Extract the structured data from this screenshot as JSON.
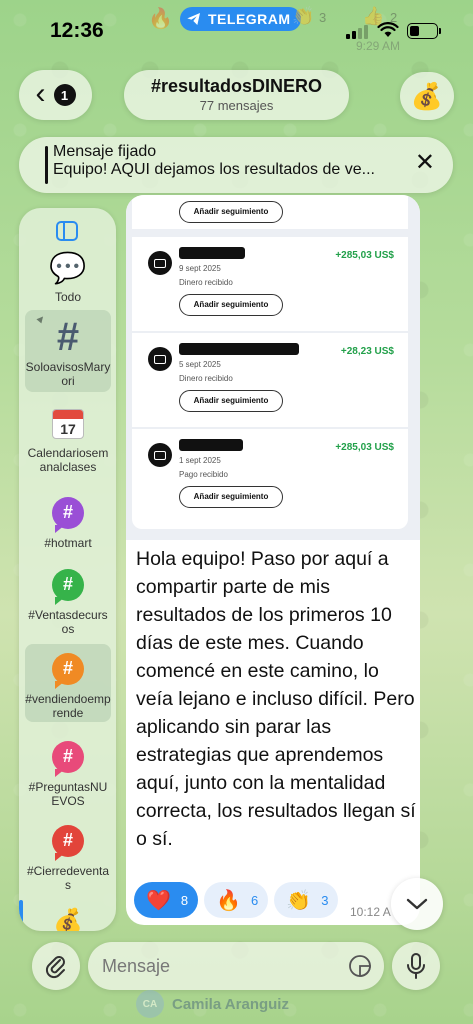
{
  "status_bar": {
    "time": "12:36",
    "telegram_label": "TELEGRAM",
    "faded_time": "9:29 AM",
    "faded_count_1": "3",
    "faded_count_2": "2"
  },
  "header": {
    "back_badge": "1",
    "title": "#resultadosDINERO",
    "subtitle": "77 mensajes",
    "avatar_emoji": "💰"
  },
  "pinned": {
    "label": "Mensaje fijado",
    "text": "Equipo! AQUI dejamos los resultados de ve..."
  },
  "sidebar": {
    "items": [
      {
        "label": "Todo",
        "icon": "chat-bubbles-icon"
      },
      {
        "label": "SoloavisosMaryori",
        "icon": "hash-icon"
      },
      {
        "label": "Calendariosemanalclases",
        "icon": "calendar-icon",
        "day": "17"
      },
      {
        "label": "#hotmart",
        "icon": "hash-icon",
        "color": "#9a4fd6"
      },
      {
        "label": "#Ventasdecursos",
        "icon": "hash-icon",
        "color": "#36b34a"
      },
      {
        "label": "#vendiendoemprende",
        "icon": "hash-icon",
        "color": "#f08a24"
      },
      {
        "label": "#PreguntasNUEVOS",
        "icon": "hash-icon",
        "color": "#e84a7a"
      },
      {
        "label": "#Cierredeventas",
        "icon": "hash-icon",
        "color": "#e2443a"
      }
    ]
  },
  "screenshot_cards": [
    {
      "follow": "Añadir seguimiento"
    },
    {
      "amount": "+285,03 US$",
      "date": "9 sept 2025",
      "kind": "Dinero recibido",
      "follow": "Añadir seguimiento"
    },
    {
      "amount": "+28,23 US$",
      "date": "5 sept 2025",
      "kind": "Dinero recibido",
      "follow": "Añadir seguimiento"
    },
    {
      "amount": "+285,03 US$",
      "date": "1 sept 2025",
      "kind": "Pago recibido",
      "follow": "Añadir seguimiento"
    }
  ],
  "message": {
    "text": "Hola equipo! Paso por aquí a compartir parte de mis resultados de los primeros 10 días de este mes. Cuando comencé en este camino, lo veía lejano e incluso difícil. Pero aplicando sin parar las estrategias que aprendemos aquí, junto con la mentalidad correcta, los resultados llegan sí o sí.",
    "time": "10:12 A",
    "reactions": [
      {
        "emoji": "❤️",
        "count": "8",
        "selected": true
      },
      {
        "emoji": "🔥",
        "count": "6",
        "selected": false
      },
      {
        "emoji": "👏",
        "count": "3",
        "selected": false
      }
    ]
  },
  "composer": {
    "placeholder": "Mensaje"
  },
  "below": {
    "initials": "CA",
    "name": "Camila Aranguiz"
  },
  "colors": {
    "accent": "#2a8cf0",
    "amount_green": "#22a04a"
  }
}
